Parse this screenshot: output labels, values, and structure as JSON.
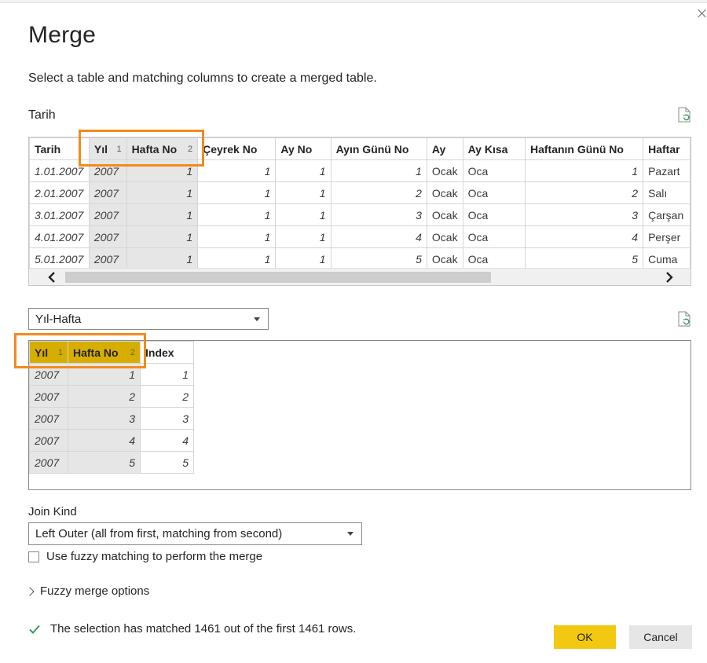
{
  "dialog": {
    "title": "Merge",
    "subtitle": "Select a table and matching columns to create a merged table."
  },
  "first_table": {
    "name": "Tarih",
    "columns": [
      {
        "label": "Tarih",
        "order": ""
      },
      {
        "label": "Yıl",
        "order": "1"
      },
      {
        "label": "Hafta No",
        "order": "2"
      },
      {
        "label": "Çeyrek No",
        "order": ""
      },
      {
        "label": "Ay No",
        "order": ""
      },
      {
        "label": "Ayın Günü No",
        "order": ""
      },
      {
        "label": "Ay",
        "order": ""
      },
      {
        "label": "Ay Kısa",
        "order": ""
      },
      {
        "label": "Haftanın Günü No",
        "order": ""
      },
      {
        "label": "Haftar",
        "order": ""
      }
    ],
    "rows": [
      [
        "1.01.2007",
        "2007",
        "1",
        "1",
        "1",
        "1",
        "Ocak",
        "Oca",
        "1",
        "Pazart"
      ],
      [
        "2.01.2007",
        "2007",
        "1",
        "1",
        "1",
        "2",
        "Ocak",
        "Oca",
        "2",
        "Salı"
      ],
      [
        "3.01.2007",
        "2007",
        "1",
        "1",
        "1",
        "3",
        "Ocak",
        "Oca",
        "3",
        "Çarşan"
      ],
      [
        "4.01.2007",
        "2007",
        "1",
        "1",
        "1",
        "4",
        "Ocak",
        "Oca",
        "4",
        "Perşer"
      ],
      [
        "5.01.2007",
        "2007",
        "1",
        "1",
        "1",
        "5",
        "Ocak",
        "Oca",
        "5",
        "Cuma"
      ]
    ]
  },
  "second_table": {
    "selected": "Yıl-Hafta",
    "columns": [
      {
        "label": "Yıl",
        "order": "1"
      },
      {
        "label": "Hafta No",
        "order": "2"
      },
      {
        "label": "Index",
        "order": ""
      }
    ],
    "rows": [
      [
        "2007",
        "1",
        "1"
      ],
      [
        "2007",
        "2",
        "2"
      ],
      [
        "2007",
        "3",
        "3"
      ],
      [
        "2007",
        "4",
        "4"
      ],
      [
        "2007",
        "5",
        "5"
      ]
    ]
  },
  "join": {
    "label": "Join Kind",
    "selected": "Left Outer (all from first, matching from second)",
    "fuzzy_checkbox_label": "Use fuzzy matching to perform the merge",
    "fuzzy_checked": false,
    "fuzzy_options_label": "Fuzzy merge options"
  },
  "status": {
    "text": "The selection has matched 1461 out of the first 1461 rows.",
    "color": "#3a9a5e"
  },
  "buttons": {
    "ok": "OK",
    "cancel": "Cancel"
  },
  "colors": {
    "accent": "#f2c811",
    "highlight_outline": "#f28a1e",
    "selected_header": "#d6ae00"
  },
  "icons": [
    "close-icon",
    "refresh-preview-icon",
    "scroll-left-icon",
    "scroll-right-icon",
    "dropdown-caret-icon",
    "chevron-right-icon",
    "checkmark-icon"
  ]
}
